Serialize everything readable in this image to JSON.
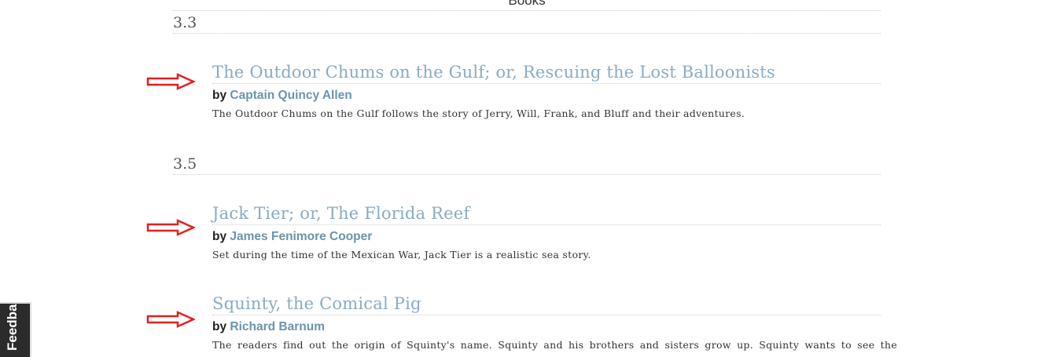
{
  "page": {
    "heading": "Books"
  },
  "sections": [
    {
      "number": "3.3",
      "books": [
        {
          "title": "The Outdoor Chums on the Gulf; or, Rescuing the Lost Balloonists",
          "by": "by",
          "author": "Captain Quincy Allen",
          "description": "The Outdoor Chums on the Gulf follows the story of Jerry, Will, Frank, and Bluff and their adventures."
        }
      ]
    },
    {
      "number": "3.5",
      "books": [
        {
          "title": "Jack Tier; or, The Florida Reef",
          "by": "by",
          "author": "James Fenimore Cooper",
          "description": "Set during the time of the Mexican War, Jack Tier is a realistic sea story."
        },
        {
          "title": "Squinty, the Comical Pig",
          "by": "by",
          "author": "Richard Barnum",
          "description": "The readers find out the origin of Squinty's name. Squinty and his brothers and sisters grow up. Squinty wants to see the"
        }
      ]
    }
  ],
  "annotation_color": "#e02020",
  "feedback_tab": {
    "label": "Feedback"
  }
}
